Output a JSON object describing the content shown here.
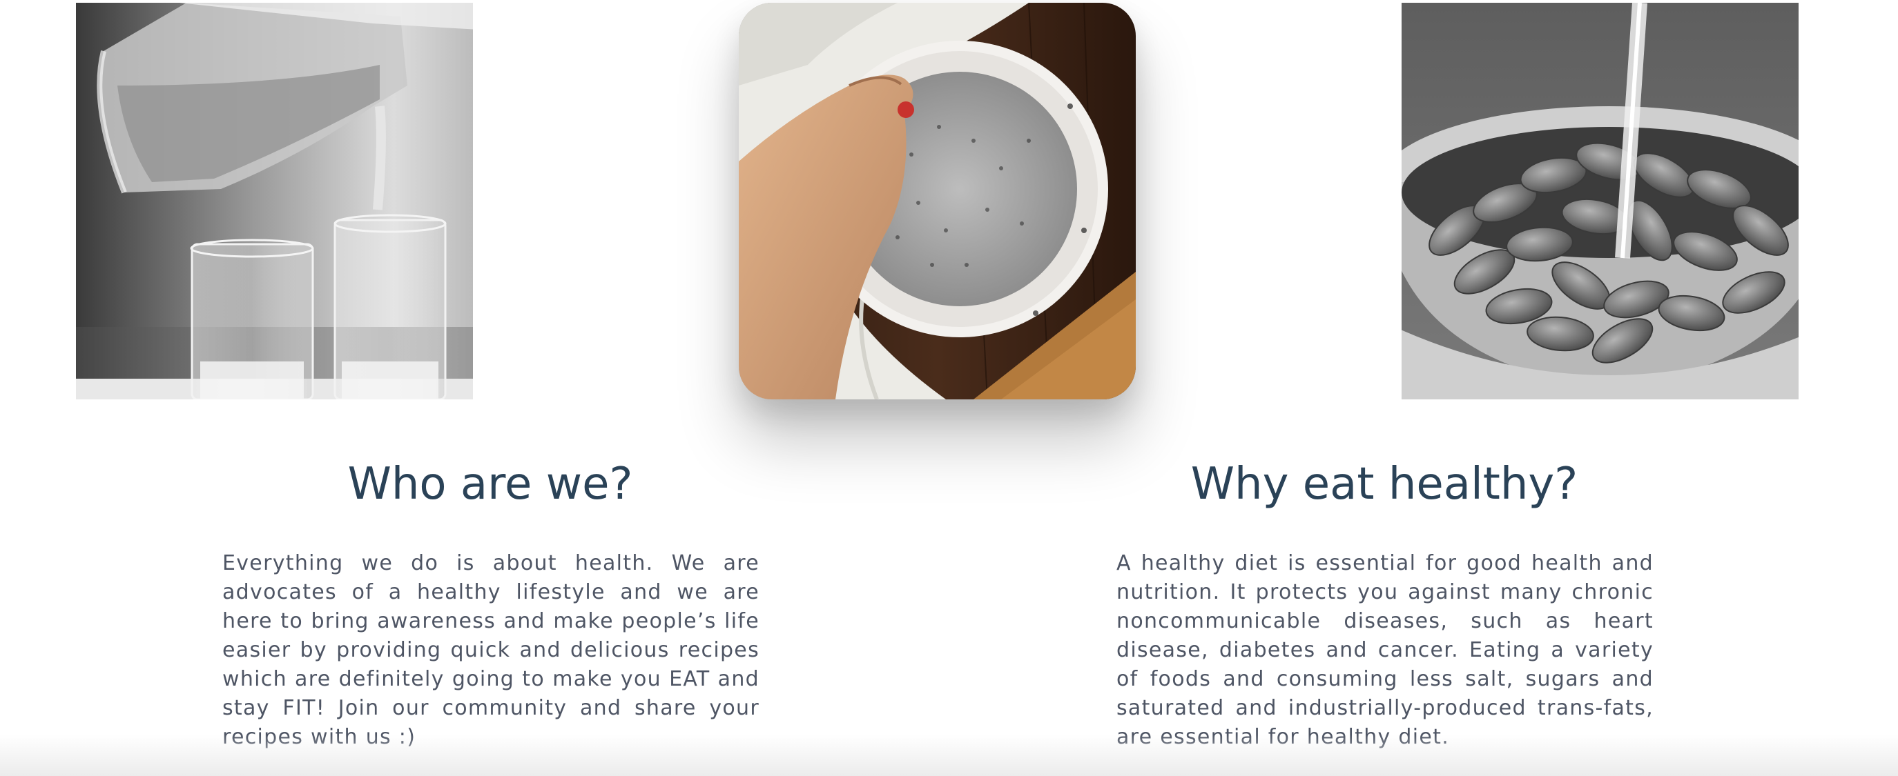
{
  "images": {
    "left": {
      "icon": "glass-pitcher-pouring-photo"
    },
    "center": {
      "icon": "chia-pudding-bowl-photo"
    },
    "right": {
      "icon": "almonds-bowl-water-photo"
    }
  },
  "about": {
    "title": "Who are we?",
    "text": "Everything we do is about health. We are advocates of a healthy lifestyle and we are here to bring awareness and make people’s life easier by providing quick and delicious recipes which are definitely going to make you EAT and stay FIT! Join our community and share your recipes with us :)"
  },
  "why": {
    "title": "Why eat healthy?",
    "text": "A healthy diet is essential for good health and nutrition. It protects you against many chronic noncommunicable diseases, such as heart disease, diabetes and cancer. Eating a variety of foods and consuming less salt, sugars and saturated and industrially-produced trans-fats, are essential for healthy diet."
  },
  "colors": {
    "heading": "#2a4257",
    "body_text": "#4e5564",
    "background": "#ffffff"
  }
}
